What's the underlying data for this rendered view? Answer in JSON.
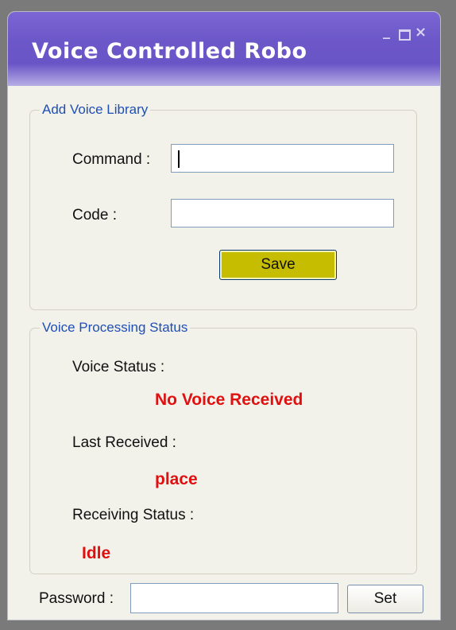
{
  "window": {
    "title": "Voice Controlled Robo",
    "controls": {
      "minimize": "_",
      "close": "×"
    }
  },
  "add_voice_library": {
    "legend": "Add Voice Library",
    "command_label": "Command :",
    "command_value": "",
    "code_label": "Code :",
    "code_value": "",
    "save_label": "Save"
  },
  "voice_processing_status": {
    "legend": "Voice Processing Status",
    "voice_status_label": "Voice Status :",
    "voice_status_value": "No Voice Received",
    "last_received_label": "Last Received :",
    "last_received_value": "place",
    "receiving_status_label": "Receiving Status :",
    "receiving_status_value": "Idle"
  },
  "password": {
    "label": "Password :",
    "value": "",
    "set_label": "Set"
  },
  "colors": {
    "title_bar": "#6a55c7",
    "legend_text": "#1f4fb5",
    "status_text": "#e01010",
    "save_button": "#c6bd00"
  }
}
